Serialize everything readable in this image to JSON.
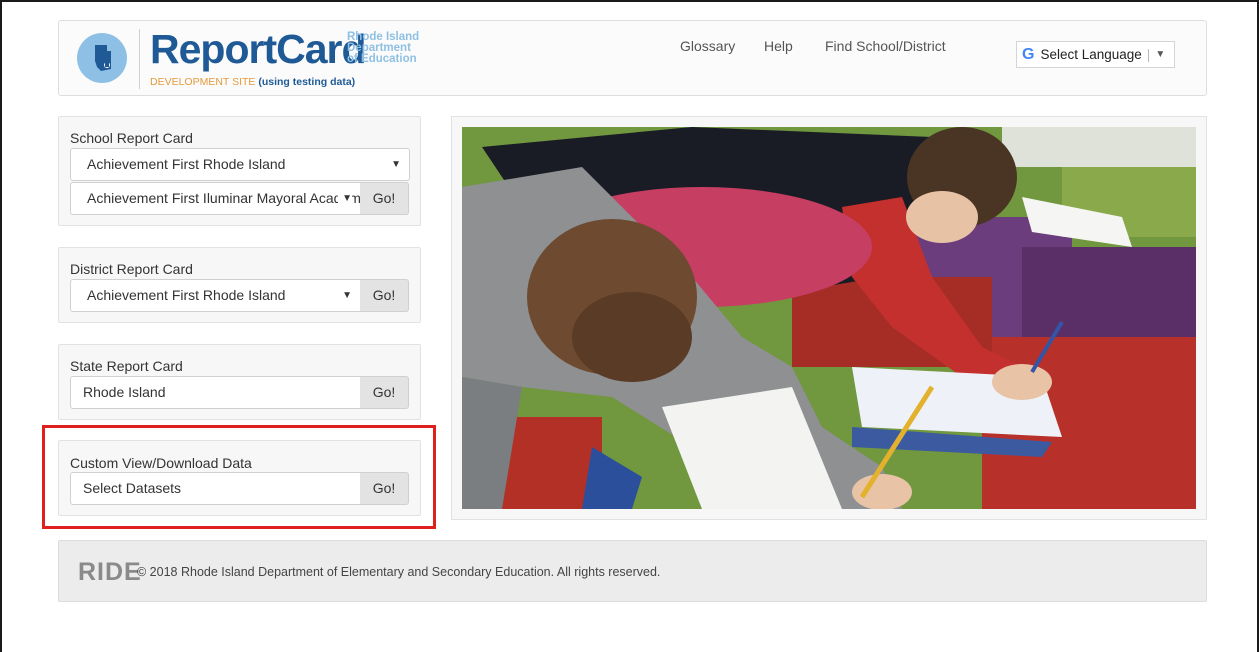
{
  "header": {
    "logo_word": "ReportCard",
    "logo_dept_line1": "Rhode Island",
    "logo_dept_line2": "Department",
    "logo_dept_line3": "of Education",
    "dev_site": "DEVELOPMENT SITE",
    "dev_testing": "(using testing data)",
    "nav": {
      "glossary": "Glossary",
      "help": "Help",
      "find": "Find School/District"
    },
    "translate": {
      "label": "Select Language",
      "icon": "google-g-icon"
    }
  },
  "school_panel": {
    "title": "School Report Card",
    "district_select": "Achievement First Rhode Island",
    "school_select": "Achievement First Iluminar Mayoral Academy",
    "go": "Go!"
  },
  "district_panel": {
    "title": "District Report Card",
    "district_select": "Achievement First Rhode Island",
    "go": "Go!"
  },
  "state_panel": {
    "title": "State Report Card",
    "value": "Rhode Island",
    "go": "Go!"
  },
  "custom_panel": {
    "title": "Custom View/Download Data",
    "value": "Select Datasets",
    "go": "Go!"
  },
  "footer": {
    "logo": "RIDE",
    "copyright": "© 2018 Rhode Island Department of Elementary and Secondary Education. All rights reserved."
  },
  "colors": {
    "brand_blue": "#1f5a96",
    "light_blue": "#8fc0e4",
    "dev_orange": "#e59a3c",
    "highlight_red": "#e0201e"
  }
}
